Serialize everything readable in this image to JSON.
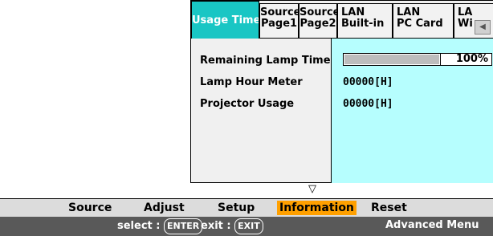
{
  "tabs": [
    {
      "label1": "Usage Time",
      "label2": ""
    },
    {
      "label1": "Source",
      "label2": "Page1"
    },
    {
      "label1": "Source",
      "label2": "Page2"
    },
    {
      "label1": "LAN",
      "label2": "Built-in"
    },
    {
      "label1": "LAN",
      "label2": "PC Card"
    },
    {
      "label1": "LA",
      "label2": "Wi"
    }
  ],
  "scroll_left_icon": "triangle-left",
  "rows": [
    {
      "label": "Remaining Lamp Time",
      "value": "100%"
    },
    {
      "label": "Lamp Hour Meter",
      "value": "00000[H]"
    },
    {
      "label": "Projector Usage",
      "value": "00000[H]"
    }
  ],
  "lamp_progress_fraction": 1.0,
  "down_arrow": "▽",
  "menu": [
    "Source",
    "Adjust",
    "Setup",
    "Information",
    "Reset"
  ],
  "menu_selected": "Information",
  "hint": {
    "select_label": "select :",
    "select_key": "ENTER",
    "exit_label": "exit :",
    "exit_key": "EXIT",
    "mode": "Advanced Menu"
  },
  "colors": {
    "active_tab": "#19c6c4",
    "value_area": "#b6fefe",
    "menu_selected": "#ffa000",
    "hint_bar": "#595959"
  }
}
